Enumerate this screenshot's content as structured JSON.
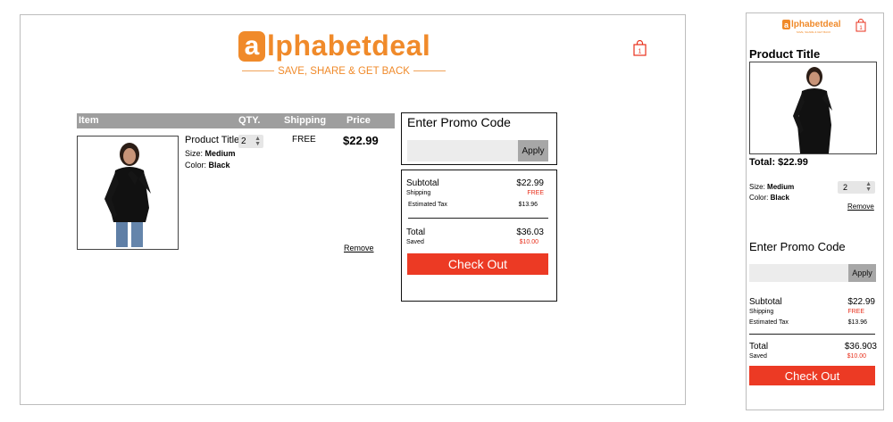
{
  "brand": {
    "logo_letter": "a",
    "logo_text": "lphabetdeal",
    "tagline": "SAVE, SHARE & GET BACK"
  },
  "cart": {
    "count": "1"
  },
  "desktop": {
    "columns": {
      "item": "Item",
      "qty": "QTY.",
      "shipping": "Shipping",
      "price": "Price"
    },
    "product": {
      "title": "Product Title",
      "size_label": "Size:",
      "size_value": "Medium",
      "color_label": "Color:",
      "color_value": "Black",
      "qty": "2",
      "shipping": "FREE",
      "price": "$22.99",
      "remove": "Remove"
    },
    "promo": {
      "title": "Enter Promo Code",
      "placeholder": "",
      "apply": "Apply"
    },
    "summary": {
      "subtotal_label": "Subtotal",
      "subtotal": "$22.99",
      "shipping_label": "Shipping",
      "shipping": "FREE",
      "tax_label": "Estimated Tax",
      "tax": "$13.96",
      "total_label": "Total",
      "total": "$36.03",
      "saved_label": "Saved",
      "saved": "$10.00",
      "checkout": "Check Out"
    }
  },
  "mobile": {
    "title": "Product Title",
    "total_line": "Total: $22.99",
    "size_label": "Size:",
    "size_value": "Medium",
    "color_label": "Color:",
    "color_value": "Black",
    "qty": "2",
    "remove": "Remove",
    "promo": {
      "title": "Enter Promo Code",
      "placeholder": "",
      "apply": "Apply"
    },
    "summary": {
      "subtotal_label": "Subtotal",
      "subtotal": "$22.99",
      "shipping_label": "Shipping",
      "shipping": "FREE",
      "tax_label": "Estimated Tax",
      "tax": "$13.96",
      "total_label": "Total",
      "total": "$36.903",
      "saved_label": "Saved",
      "saved": "$10.00",
      "checkout": "Check Out"
    }
  },
  "colors": {
    "brand_orange": "#f08a2a",
    "accent_red": "#ec3a24",
    "header_gray": "#9e9e9e"
  }
}
